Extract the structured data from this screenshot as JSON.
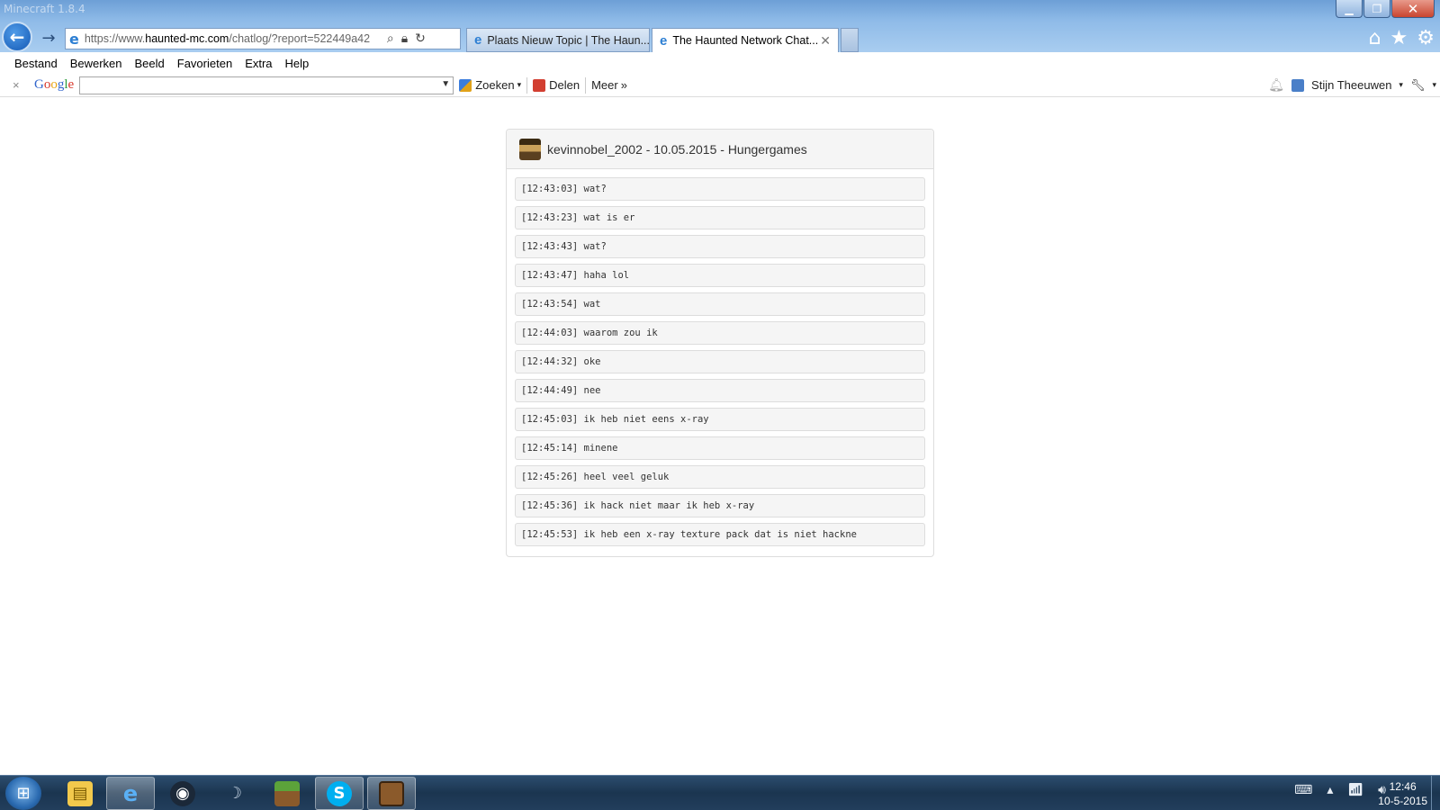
{
  "window": {
    "ghost_title": "Minecraft 1.8.4",
    "controls": {
      "minimize": "▁",
      "restore": "❐",
      "close": "✕"
    }
  },
  "browser": {
    "address_prefix": "https://www.",
    "address_domain": "haunted-mc.com",
    "address_path": "/chatlog/?report=522449a42",
    "tabs": [
      {
        "label": "Plaats Nieuw Topic | The Haun..."
      },
      {
        "label": "The Haunted Network Chat..."
      }
    ],
    "icons": [
      "home-icon",
      "star-icon",
      "gear-icon"
    ]
  },
  "menu": [
    "Bestand",
    "Bewerken",
    "Beeld",
    "Favorieten",
    "Extra",
    "Help"
  ],
  "google_toolbar": {
    "close": "×",
    "logo": [
      "G",
      "o",
      "o",
      "g",
      "l",
      "e"
    ],
    "search_value": "",
    "search_button": "Zoeken",
    "share_button": "Delen",
    "more_button": "Meer",
    "user_name": "Stijn Theeuwen"
  },
  "chatlog": {
    "title": "kevinnobel_2002 - 10.05.2015 - Hungergames",
    "lines": [
      "[12:43:03] wat?",
      "[12:43:23] wat is er",
      "[12:43:43] wat?",
      "[12:43:47] haha lol",
      "[12:43:54] wat",
      "[12:44:03] waarom zou ik",
      "[12:44:32] oke",
      "[12:44:49] nee",
      "[12:45:03] ik heb niet eens x-ray",
      "[12:45:14] minene",
      "[12:45:26] heel veel geluk",
      "[12:45:36] ik hack niet maar ik heb x-ray",
      "[12:45:53] ik heb een x-ray texture pack dat is niet hackne"
    ]
  },
  "taskbar": {
    "apps": [
      "start-button",
      "file-explorer-icon",
      "internet-explorer-icon",
      "steam-icon",
      "app-icon",
      "minecraft-icon",
      "skype-icon",
      "minecraft-launcher-icon"
    ],
    "time": "12:46",
    "date": "10-5-2015"
  },
  "colors": {
    "link_blue": "#2d7fd3",
    "taskbar": "#1b3550",
    "panel_bg": "#f5f5f5"
  }
}
